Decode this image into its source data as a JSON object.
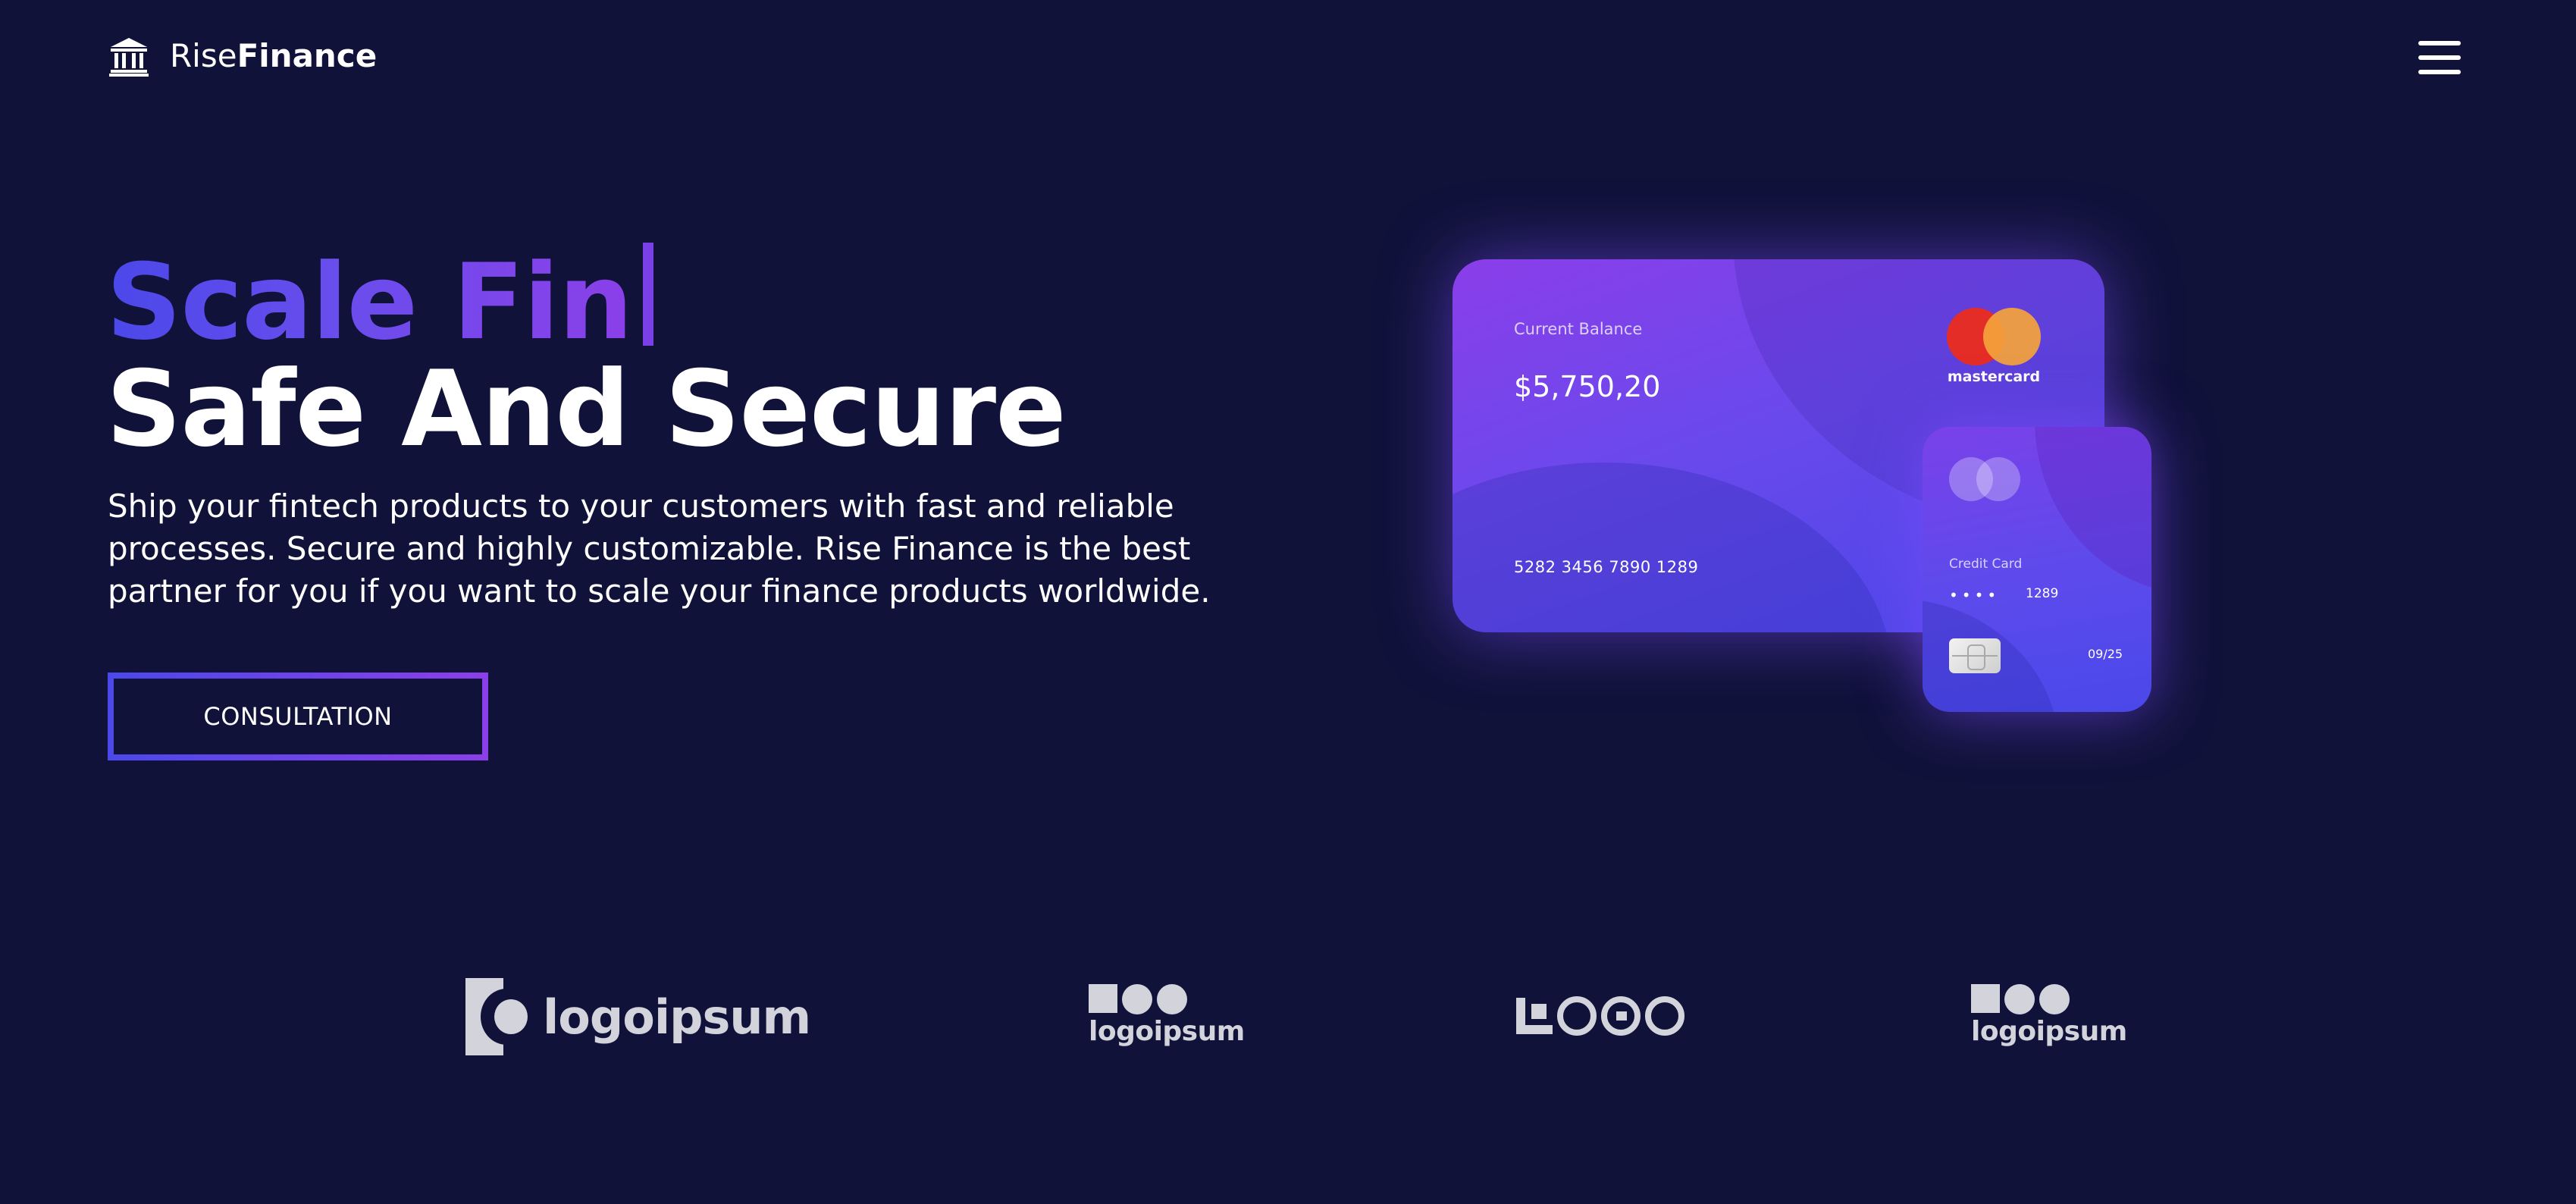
{
  "header": {
    "brand_light": "Rise",
    "brand_bold": "Finance",
    "logo_icon": "bank-icon",
    "menu_icon": "hamburger-menu-icon"
  },
  "hero": {
    "headline_typed": "Scale Fin",
    "headline_line2": "Safe And Secure",
    "subtext": "Ship your fintech products to your customers with fast and reliable processes. Secure and highly customizable. Rise Finance is the best partner for you if you want to scale your finance products worldwide.",
    "cta_label": "CONSULTATION"
  },
  "card_main": {
    "label": "Current Balance",
    "balance": "$5,750,20",
    "number": "5282 3456 7890 1289",
    "network": "mastercard"
  },
  "card_small": {
    "label": "Credit Card",
    "masked": "••••",
    "last4": "1289",
    "expiry": "09/25"
  },
  "partner_logos": {
    "logo1": "logoipsum",
    "logo2": "logoipsum",
    "logo3": "LOGO",
    "logo4": "logoipsum"
  },
  "colors": {
    "background": "#10123a",
    "gradient_start": "#4b48ea",
    "gradient_end": "#8b3fe8",
    "mastercard_red": "#e52d27",
    "mastercard_orange": "#f5a33b",
    "logo_gray": "#d3d3dc"
  }
}
